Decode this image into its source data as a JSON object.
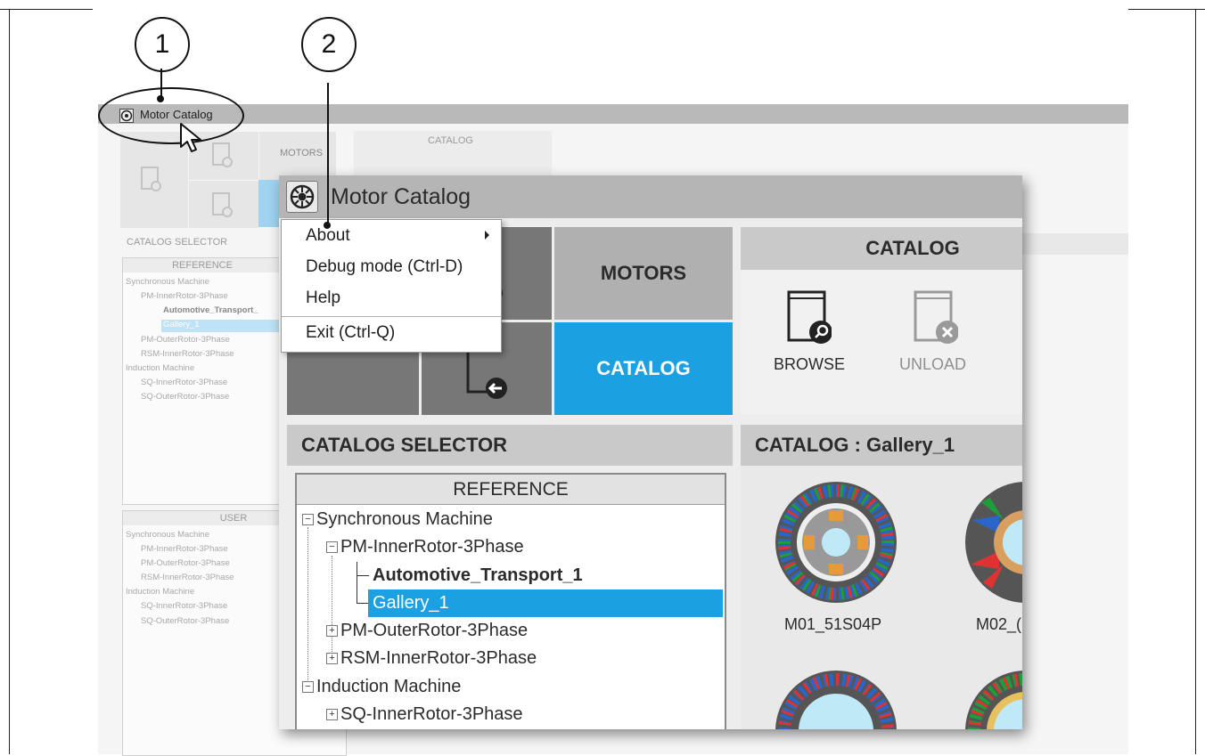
{
  "callouts": {
    "one": "1",
    "two": "2"
  },
  "background_app": {
    "title": "Motor Catalog",
    "motors_label": "MOTORS",
    "catalog_label": "CATALOG",
    "selector_label": "CATALOG SELECTOR",
    "reference_header": "REFERENCE",
    "reference_tree": [
      "Synchronous Machine",
      "PM-InnerRotor-3Phase",
      "Automotive_Transport_",
      "Gallery_1",
      "PM-OuterRotor-3Phase",
      "RSM-InnerRotor-3Phase",
      "Induction Machine",
      "SQ-InnerRotor-3Phase",
      "SQ-OuterRotor-3Phase"
    ],
    "user_header": "USER",
    "user_tree": [
      "Synchronous Machine",
      "PM-InnerRotor-3Phase",
      "PM-OuterRotor-3Phase",
      "RSM-InnerRotor-3Phase",
      "Induction Machine",
      "SQ-InnerRotor-3Phase",
      "SQ-OuterRotor-3Phase"
    ]
  },
  "window": {
    "title": "Motor Catalog",
    "motors_button": "MOTORS",
    "catalog_button": "CATALOG",
    "catalog_panel": {
      "title": "CATALOG",
      "browse": "BROWSE",
      "unload": "UNLOAD"
    },
    "selector": {
      "title": "CATALOG SELECTOR",
      "reference_header": "REFERENCE",
      "tree": {
        "sync": "Synchronous Machine",
        "pm_inner": "PM-InnerRotor-3Phase",
        "automotive": "Automotive_Transport_1",
        "gallery": "Gallery_1",
        "pm_outer": "PM-OuterRotor-3Phase",
        "rsm_inner": "RSM-InnerRotor-3Phase",
        "induction": "Induction Machine",
        "sq_inner": "SQ-InnerRotor-3Phase"
      }
    },
    "gallery": {
      "title": "CATALOG : Gallery_1",
      "items": [
        "M01_51S04P",
        "M02_("
      ]
    }
  },
  "context_menu": {
    "items": [
      "About",
      "Debug mode (Ctrl-D)",
      "Help",
      "Exit (Ctrl-Q)"
    ]
  },
  "colors": {
    "accent": "#1ba1e2",
    "titlebar": "#b5b5b5",
    "tile_dark": "#777777"
  }
}
